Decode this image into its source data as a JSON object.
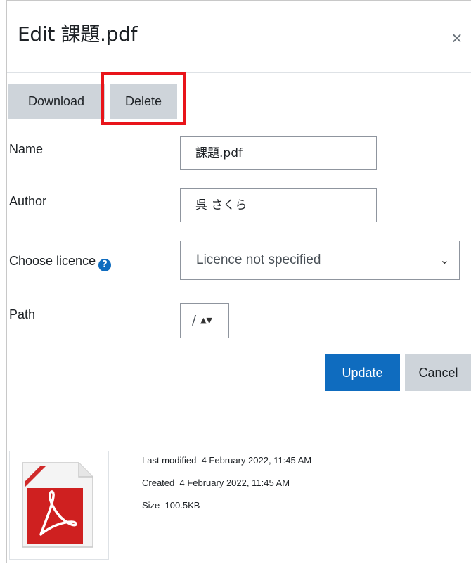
{
  "dialog": {
    "title": "Edit 課題.pdf",
    "close_icon": "close-icon"
  },
  "actions": {
    "download_label": "Download",
    "delete_label": "Delete",
    "highlight_color": "#e8141a"
  },
  "form": {
    "name_label": "Name",
    "name_value": "課題.pdf",
    "author_label": "Author",
    "author_value": "呉 さくら",
    "licence_label": "Choose licence",
    "licence_help_icon": "question-circle-icon",
    "licence_value": "Licence not specified",
    "path_label": "Path",
    "path_value": "/"
  },
  "buttons": {
    "update_label": "Update",
    "cancel_label": "Cancel",
    "primary_color": "#0f6cbf"
  },
  "file_info": {
    "icon": "pdf-file-icon",
    "last_modified_label": "Last modified",
    "last_modified_value": "4 February 2022, 11:45 AM",
    "created_label": "Created",
    "created_value": "4 February 2022, 11:45 AM",
    "size_label": "Size",
    "size_value": "100.5KB"
  }
}
